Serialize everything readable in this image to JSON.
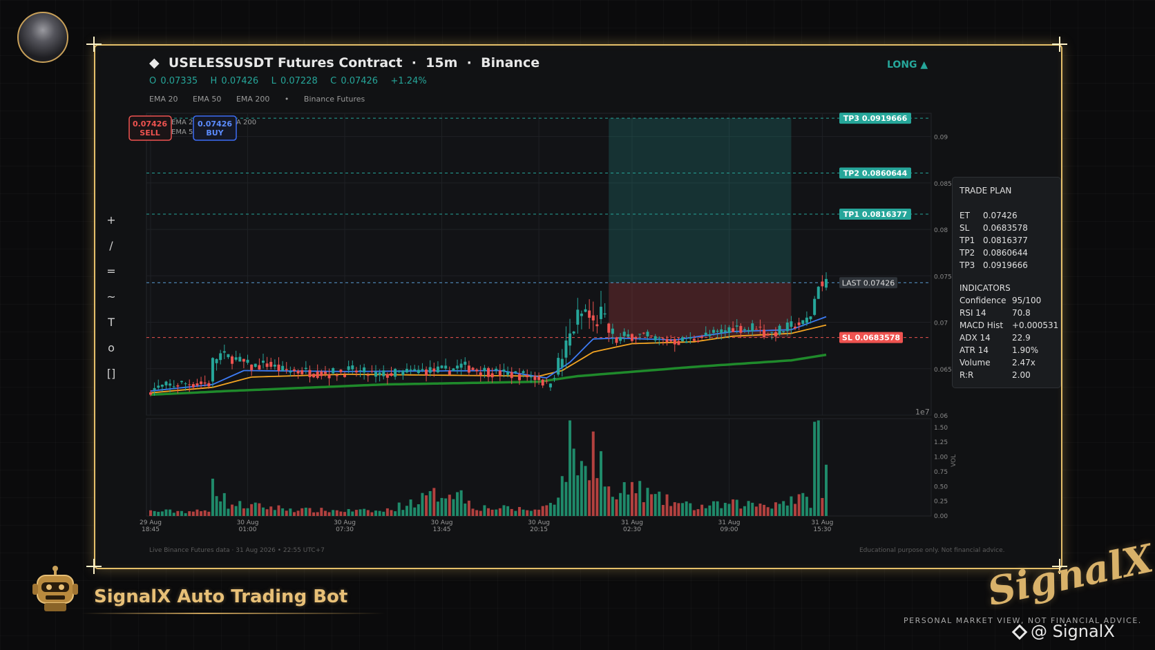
{
  "header": {
    "diamond": "◆",
    "title": "USELESSUSDT Futures Contract  ·  15m  ·  Binance",
    "ohlc": "O 0.07335   H 0.07426   L 0.07228   C 0.07426   +1.24%",
    "ema_labels": [
      "EMA 20",
      "EMA 50",
      "EMA 200",
      "•",
      "Binance Futures"
    ],
    "direction": "LONG ▲"
  },
  "toolbar": [
    "+",
    "/",
    "=",
    "~",
    "T",
    "o",
    "[]"
  ],
  "price_buttons": {
    "sell_price": "0.07426",
    "sell_label": "SELL",
    "buy_price": "0.07426",
    "buy_label": "BUY",
    "legend_fragments": [
      "EMA 2",
      "EMA 5",
      "A 200"
    ]
  },
  "levels": {
    "tp3": {
      "label": "TP3  0.0919666",
      "value": 0.0919666
    },
    "tp2": {
      "label": "TP2  0.0860644",
      "value": 0.0860644
    },
    "tp1": {
      "label": "TP1  0.0816377",
      "value": 0.0816377
    },
    "last": {
      "label": "LAST  0.07426",
      "value": 0.07426
    },
    "sl": {
      "label": "SL  0.0683578",
      "value": 0.0683578
    }
  },
  "trade_plan": {
    "title": "TRADE PLAN",
    "rows": [
      [
        "ET",
        "0.07426"
      ],
      [
        "SL",
        "0.0683578"
      ],
      [
        "TP1",
        "0.0816377"
      ],
      [
        "TP2",
        "0.0860644"
      ],
      [
        "TP3",
        "0.0919666"
      ]
    ],
    "ind_title": "INDICATORS",
    "indicators": [
      [
        "Confidence",
        "95/100"
      ],
      [
        "RSI 14",
        "70.8"
      ],
      [
        "MACD Hist",
        "+0.000531"
      ],
      [
        "ADX 14",
        "22.9"
      ],
      [
        "ATR 14",
        "1.90%"
      ],
      [
        "Volume",
        "2.47x"
      ],
      [
        "R:R",
        "2.00"
      ]
    ]
  },
  "footer": {
    "left": "Live Binance Futures data  ·  31 Aug 2026 • 22:55 UTC+7",
    "right": "Educational purpose only. Not financial advice."
  },
  "branding": {
    "bot_name": "SignalX Auto Trading Bot",
    "logo": "SignalX",
    "disclaimer": "PERSONAL MARKET VIEW, NOT FINANCIAL ADVICE.",
    "handle": "@ SignalX"
  },
  "colors": {
    "up": "#26a69a",
    "down": "#ef5350",
    "ema20": "#3d7cf5",
    "ema50": "#f5a623",
    "ema200": "#1f8a2b",
    "gold": "#e6c06a"
  },
  "chart_data": {
    "type": "candlestick",
    "timeframe": "15m",
    "price_axis": {
      "ylim": [
        0.06,
        0.0925
      ],
      "ticks": [
        "0.09",
        "0.085",
        "0.08",
        "0.075",
        "0.07",
        "0.065",
        "0.06"
      ],
      "tick_values": [
        0.09,
        0.085,
        0.08,
        0.075,
        0.07,
        0.065,
        0.06
      ],
      "offset_label": "1e7"
    },
    "volume_axis": {
      "label": "VOL",
      "ylim": [
        0,
        1.65
      ],
      "ticks": [
        "0.00",
        "0.25",
        "0.50",
        "0.75",
        "1.00",
        "1.25",
        "1.50"
      ],
      "tick_values": [
        0,
        0.25,
        0.5,
        0.75,
        1.0,
        1.25,
        1.5
      ]
    },
    "x_ticks": [
      {
        "i": 0,
        "label": [
          "29 Aug",
          "18:45"
        ]
      },
      {
        "i": 25,
        "label": [
          "30 Aug",
          "01:00"
        ]
      },
      {
        "i": 50,
        "label": [
          "30 Aug",
          "07:30"
        ]
      },
      {
        "i": 75,
        "label": [
          "30 Aug",
          "13:45"
        ]
      },
      {
        "i": 100,
        "label": [
          "30 Aug",
          "20:15"
        ]
      },
      {
        "i": 124,
        "label": [
          "31 Aug",
          "02:30"
        ]
      },
      {
        "i": 149,
        "label": [
          "31 Aug",
          "09:00"
        ]
      },
      {
        "i": 173,
        "label": [
          "31 Aug",
          "15:30"
        ]
      }
    ],
    "trade_zone": {
      "start_i": 118,
      "end_i": 165,
      "entry": 0.07426,
      "sl": 0.0683578,
      "tp3": 0.0919666
    },
    "close_anchors": [
      [
        0,
        0.0628
      ],
      [
        8,
        0.0634
      ],
      [
        15,
        0.0634
      ],
      [
        16,
        0.0658
      ],
      [
        18,
        0.0665
      ],
      [
        22,
        0.066
      ],
      [
        26,
        0.0652
      ],
      [
        30,
        0.0655
      ],
      [
        34,
        0.0648
      ],
      [
        40,
        0.0647
      ],
      [
        46,
        0.0645
      ],
      [
        52,
        0.0648
      ],
      [
        58,
        0.0643
      ],
      [
        64,
        0.0645
      ],
      [
        70,
        0.0648
      ],
      [
        76,
        0.0648
      ],
      [
        80,
        0.0653
      ],
      [
        84,
        0.0649
      ],
      [
        90,
        0.0645
      ],
      [
        96,
        0.0643
      ],
      [
        100,
        0.064
      ],
      [
        102,
        0.0632
      ],
      [
        104,
        0.0645
      ],
      [
        106,
        0.0662
      ],
      [
        108,
        0.0685
      ],
      [
        110,
        0.0705
      ],
      [
        112,
        0.0712
      ],
      [
        114,
        0.0697
      ],
      [
        116,
        0.0708
      ],
      [
        118,
        0.069
      ],
      [
        120,
        0.068
      ],
      [
        122,
        0.0685
      ],
      [
        126,
        0.0686
      ],
      [
        130,
        0.0682
      ],
      [
        134,
        0.068
      ],
      [
        138,
        0.068
      ],
      [
        142,
        0.0685
      ],
      [
        146,
        0.0688
      ],
      [
        150,
        0.0695
      ],
      [
        154,
        0.0693
      ],
      [
        156,
        0.0697
      ],
      [
        158,
        0.0688
      ],
      [
        160,
        0.0688
      ],
      [
        164,
        0.0694
      ],
      [
        166,
        0.0698
      ],
      [
        168,
        0.0698
      ],
      [
        170,
        0.0708
      ],
      [
        172,
        0.0742
      ],
      [
        173,
        0.0738
      ],
      [
        174,
        0.07426
      ]
    ],
    "volume_anchors": [
      [
        0,
        0.08
      ],
      [
        15,
        0.08
      ],
      [
        16,
        1.02
      ],
      [
        17,
        0.45
      ],
      [
        20,
        0.2
      ],
      [
        40,
        0.1
      ],
      [
        60,
        0.08
      ],
      [
        78,
        0.45
      ],
      [
        84,
        0.15
      ],
      [
        100,
        0.1
      ],
      [
        104,
        0.3
      ],
      [
        106,
        0.55
      ],
      [
        108,
        1.2
      ],
      [
        109,
        1.38
      ],
      [
        110,
        0.9
      ],
      [
        112,
        0.7
      ],
      [
        114,
        1.35
      ],
      [
        116,
        0.9
      ],
      [
        118,
        0.4
      ],
      [
        120,
        0.3
      ],
      [
        124,
        0.5
      ],
      [
        130,
        0.3
      ],
      [
        140,
        0.15
      ],
      [
        150,
        0.2
      ],
      [
        160,
        0.2
      ],
      [
        166,
        0.3
      ],
      [
        170,
        0.25
      ],
      [
        171,
        1.6
      ],
      [
        172,
        1.4
      ],
      [
        173,
        0.25
      ],
      [
        174,
        0.98
      ]
    ],
    "ema20_anchors": [
      [
        0,
        0.0626
      ],
      [
        16,
        0.0633
      ],
      [
        24,
        0.0648
      ],
      [
        50,
        0.0647
      ],
      [
        90,
        0.0648
      ],
      [
        102,
        0.064
      ],
      [
        108,
        0.0657
      ],
      [
        114,
        0.0682
      ],
      [
        120,
        0.0683
      ],
      [
        135,
        0.0681
      ],
      [
        150,
        0.069
      ],
      [
        165,
        0.0692
      ],
      [
        174,
        0.0706
      ]
    ],
    "ema50_anchors": [
      [
        0,
        0.0624
      ],
      [
        16,
        0.063
      ],
      [
        26,
        0.0641
      ],
      [
        50,
        0.0644
      ],
      [
        100,
        0.0642
      ],
      [
        106,
        0.0648
      ],
      [
        114,
        0.0668
      ],
      [
        124,
        0.0677
      ],
      [
        140,
        0.0679
      ],
      [
        150,
        0.0685
      ],
      [
        165,
        0.0688
      ],
      [
        174,
        0.0697
      ]
    ],
    "ema200_anchors": [
      [
        0,
        0.0622
      ],
      [
        20,
        0.0626
      ],
      [
        60,
        0.0633
      ],
      [
        100,
        0.0636
      ],
      [
        110,
        0.0642
      ],
      [
        140,
        0.0652
      ],
      [
        165,
        0.0659
      ],
      [
        174,
        0.0665
      ]
    ]
  }
}
